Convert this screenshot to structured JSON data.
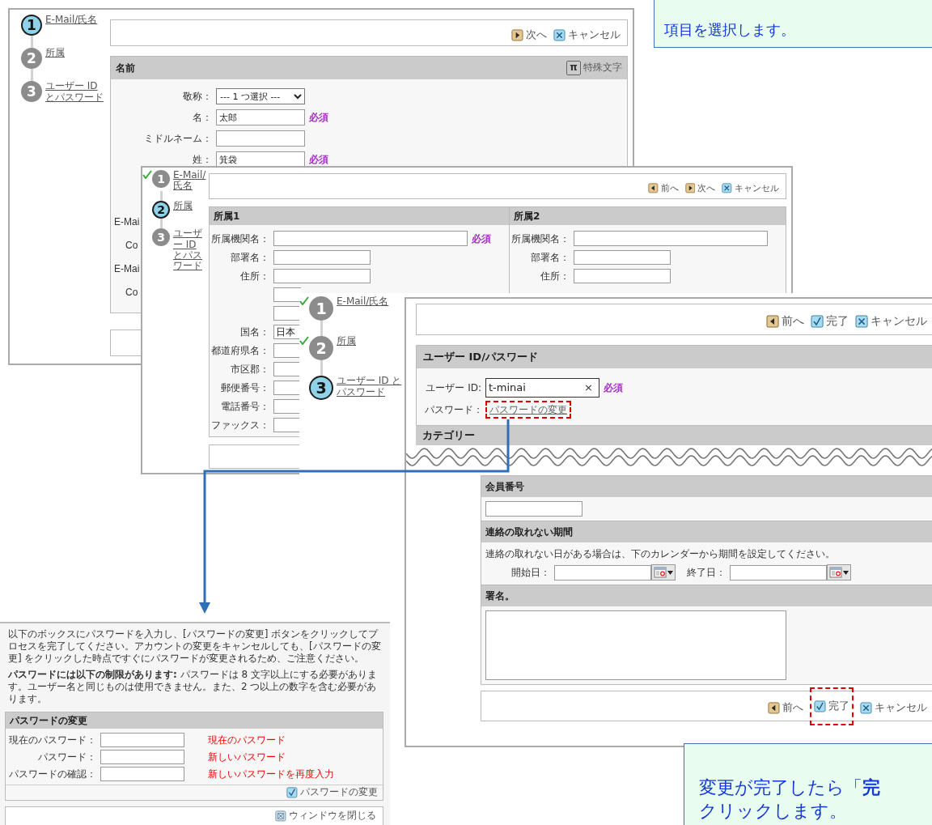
{
  "callout_top": {
    "text": "項目を選択します。"
  },
  "step1_screen": {
    "steps": [
      {
        "number": "1",
        "label": "E-Mail/氏名",
        "selected": true,
        "done": false
      },
      {
        "number": "2",
        "label": "所属",
        "selected": false,
        "done": false
      },
      {
        "number": "3",
        "label": "ユーザー ID とパスワード",
        "selected": false,
        "done": false
      }
    ],
    "toolbar": [
      {
        "kind": "next",
        "label": "次へ"
      },
      {
        "kind": "cancel",
        "label": "キャンセル"
      }
    ],
    "section": {
      "title": "名前",
      "action": {
        "icon": "π",
        "label": "特殊文字"
      },
      "fields": [
        {
          "kind": "select",
          "label": "敬称：",
          "value": "--- 1 つ選択 ---"
        },
        {
          "kind": "text",
          "label": "名：",
          "value": "太郎",
          "required": "必須"
        },
        {
          "kind": "text",
          "label": "ミドルネーム："
        },
        {
          "kind": "text",
          "label": "姓：",
          "value": "箕袋",
          "required": "必須"
        }
      ],
      "cut_labels": [
        {
          "kind": "group",
          "text": "E-Mai"
        },
        {
          "kind": "field",
          "text": "Co"
        },
        {
          "kind": "group",
          "text": "E-Mai"
        },
        {
          "kind": "field",
          "text": "Co"
        }
      ]
    }
  },
  "step2_screen": {
    "steps": [
      {
        "number": "1",
        "label": "E-Mail/氏名",
        "selected": false,
        "done": true
      },
      {
        "number": "2",
        "label": "所属",
        "selected": true,
        "done": false
      },
      {
        "number": "3",
        "label": "ユーザー ID とパスワード",
        "selected": false,
        "done": false
      }
    ],
    "toolbar": [
      {
        "kind": "back",
        "label": "前へ"
      },
      {
        "kind": "next",
        "label": "次へ"
      },
      {
        "kind": "cancel",
        "label": "キャンセル"
      }
    ],
    "columns": [
      {
        "title": "所属1",
        "fields": [
          {
            "kind": "wide-text",
            "label": "所属機関名：",
            "required": "必須"
          },
          {
            "kind": "text",
            "label": "部署名："
          },
          {
            "kind": "text",
            "label": "住所："
          },
          {
            "kind": "text"
          },
          {
            "kind": "text"
          },
          {
            "kind": "text",
            "label": "国名：",
            "value": "日本"
          },
          {
            "kind": "text",
            "label": "都道府県名："
          },
          {
            "kind": "text",
            "label": "市区郡："
          },
          {
            "kind": "text",
            "label": "郵便番号："
          },
          {
            "kind": "text",
            "label": "電話番号："
          },
          {
            "kind": "text",
            "label": "ファックス："
          }
        ]
      },
      {
        "title": "所属2",
        "fields": [
          {
            "kind": "wide-text",
            "label": "所属機関名："
          },
          {
            "kind": "text",
            "label": "部署名："
          },
          {
            "kind": "text",
            "label": "住所："
          }
        ]
      }
    ]
  },
  "step3_screen": {
    "steps": [
      {
        "number": "1",
        "label": "E-Mail/氏名",
        "selected": false,
        "done": true
      },
      {
        "number": "2",
        "label": "所属",
        "selected": false,
        "done": true
      },
      {
        "number": "3",
        "label": "ユーザー ID とパスワード",
        "selected": true,
        "done": false
      }
    ],
    "toolbar": [
      {
        "kind": "back",
        "label": "前へ"
      },
      {
        "kind": "done",
        "label": "完了"
      },
      {
        "kind": "cancel",
        "label": "キャンセル"
      }
    ],
    "section": {
      "title": "ユーザー ID/パスワード",
      "fields": [
        {
          "kind": "clearable",
          "label": "ユーザー ID:",
          "value": "t-minai",
          "clear": "×",
          "required": "必須",
          "highlighted": false
        },
        {
          "kind": "link",
          "label": "パスワード：",
          "value": "パスワードの変更",
          "highlighted": true
        }
      ]
    },
    "next_section_title": "カテゴリー",
    "lower_sections": [
      {
        "title": "会員番号",
        "fields": [
          {
            "kind": "text"
          }
        ]
      },
      {
        "title": "連絡の取れない期間",
        "note": "連絡の取れない日がある場合は、下のカレンダーから期間を設定してください。",
        "fields": [
          {
            "kind": "date",
            "label": "開始日："
          },
          {
            "kind": "date",
            "label": "終了日："
          }
        ]
      },
      {
        "title": "署名。",
        "fields": [
          {
            "kind": "textarea"
          }
        ]
      }
    ],
    "bottom_toolbar": [
      {
        "kind": "back",
        "label": "前へ",
        "highlighted": false
      },
      {
        "kind": "done",
        "label": "完了",
        "highlighted": true
      },
      {
        "kind": "cancel",
        "label": "キャンセル",
        "highlighted": false
      }
    ]
  },
  "password_dialog": {
    "paragraphs": [
      "以下のボックスにパスワードを入力し、[パスワードの変更] ボタンをクリックしてプロセスを完了してください。アカウントの変更をキャンセルしても、[パスワードの変更] をクリックした時点ですぐにパスワードが変更されるため、ご注意ください。",
      "**パスワードには以下の制限があります:** パスワードは 8 文字以上にする必要があります。ユーザー名と同じものは使用できません。また、2 つ以上の数字を含む必要があります。"
    ],
    "section": {
      "title": "パスワードの変更",
      "fields": [
        {
          "kind": "password",
          "label": "現在のパスワード：",
          "annotation": "現在のパスワード"
        },
        {
          "kind": "password",
          "label": "パスワード：",
          "annotation": "新しいパスワード"
        },
        {
          "kind": "password",
          "label": "パスワードの確認：",
          "annotation": "新しいパスワードを再度入力"
        }
      ]
    },
    "button": {
      "kind": "done",
      "label": "パスワードの変更"
    },
    "close_button": {
      "kind": "close",
      "label": "ウィンドウを閉じる"
    }
  },
  "callout_bottom": {
    "lines": [
      "変更が完了したら「**完**",
      "クリックします。"
    ]
  }
}
